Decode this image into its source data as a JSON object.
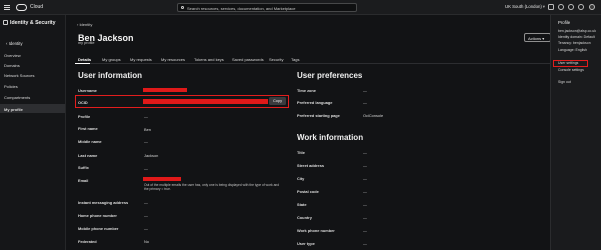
{
  "topbar": {
    "brand": "Cloud",
    "search_placeholder": "Search resources, services, documentation, and Marketplace",
    "region": "UK South (London)",
    "region_chevron": "▾"
  },
  "leftnav": {
    "title": "Identity & Security",
    "back_label": "‹  Identity",
    "items": [
      {
        "label": "Overview"
      },
      {
        "label": "Domains"
      },
      {
        "label": "Network Sources"
      },
      {
        "label": "Policies"
      },
      {
        "label": "Compartments"
      },
      {
        "label": "My profile",
        "active": true
      }
    ]
  },
  "main": {
    "breadcrumb": "›  Identity",
    "user_name": "Ben Jackson",
    "subtitle": "my profile",
    "actions_label": "Actions  ▾",
    "tabs": [
      {
        "label": "Details",
        "active": true
      },
      {
        "label": "My groups"
      },
      {
        "label": "My requests"
      },
      {
        "label": "My resources"
      },
      {
        "label": "Tokens and keys"
      },
      {
        "label": "Saved passwords"
      },
      {
        "label": "Security"
      },
      {
        "label": "Tags"
      }
    ],
    "user_information": {
      "title": "User information",
      "username_label": "Username",
      "ocid_label": "OCID",
      "copy_label": "Copy",
      "profile_label": "Profile",
      "profile_value": "—",
      "first_name_label": "First name",
      "first_name_value": "Ben",
      "middle_name_label": "Middle name",
      "middle_name_value": "—",
      "last_name_label": "Last name",
      "last_name_value": "Jackson",
      "suffix_label": "Suffix",
      "suffix_value": "—",
      "email_label": "Email",
      "email_note": "Out of the multiple emails the user has, only one is being displayed with the type of work and the primary = true.",
      "im_label": "Instant messaging address",
      "im_value": "—",
      "home_phone_label": "Home phone number",
      "home_phone_value": "—",
      "mobile_phone_label": "Mobile phone number",
      "mobile_phone_value": "—",
      "federated_label": "Federated",
      "federated_value": "No"
    },
    "user_preferences": {
      "title": "User preferences",
      "time_zone_label": "Time zone",
      "time_zone_value": "—",
      "language_label": "Preferred language",
      "language_value": "—",
      "starting_page_label": "Preferred starting page",
      "starting_page_value": "OciConsole"
    },
    "work_information": {
      "title": "Work information",
      "fields": [
        {
          "label": "Title",
          "value": "—"
        },
        {
          "label": "Street address",
          "value": "—"
        },
        {
          "label": "City",
          "value": "—"
        },
        {
          "label": "Postal code",
          "value": "—"
        },
        {
          "label": "State",
          "value": "—"
        },
        {
          "label": "Country",
          "value": "—"
        },
        {
          "label": "Work phone number",
          "value": "—"
        },
        {
          "label": "User type",
          "value": "—"
        }
      ]
    }
  },
  "profile_menu": {
    "title": "Profile",
    "items": [
      "ben.jackson@alsp.co.uk",
      "Identity domain: Default",
      "Tenancy: benjackson",
      "Language: English",
      "User settings",
      "Console settings",
      "Sign out"
    ]
  },
  "colors": {
    "background": "#111214",
    "redaction": "#e01919",
    "highlight_border": "#e21d1d"
  },
  "icons": [
    "hamburger-icon",
    "oracle-logo",
    "search-icon",
    "cloud-shell-icon",
    "bell-icon",
    "help-icon",
    "language-icon",
    "avatar-icon"
  ]
}
